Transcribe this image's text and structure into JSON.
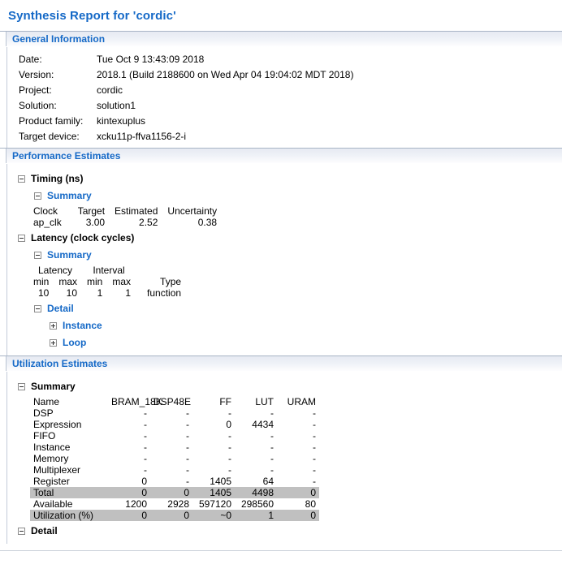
{
  "page": {
    "title": "Synthesis Report for 'cordic'"
  },
  "general_information": {
    "heading": "General Information",
    "rows": [
      {
        "label": "Date:",
        "value": "Tue Oct 9 13:43:09 2018"
      },
      {
        "label": "Version:",
        "value": "2018.1 (Build 2188600 on Wed Apr 04 19:04:02 MDT 2018)"
      },
      {
        "label": "Project:",
        "value": "cordic"
      },
      {
        "label": "Solution:",
        "value": "solution1"
      },
      {
        "label": "Product family:",
        "value": "kintexuplus"
      },
      {
        "label": "Target device:",
        "value": "xcku11p-ffva1156-2-i"
      }
    ]
  },
  "performance_estimates": {
    "heading": "Performance Estimates",
    "timing": {
      "node_label": "Timing (ns)",
      "summary_label": "Summary",
      "headers": [
        "Clock",
        "Target",
        "Estimated",
        "Uncertainty"
      ],
      "rows": [
        {
          "clock": "ap_clk",
          "target": "3.00",
          "estimated": "2.52",
          "uncertainty": "0.38"
        }
      ]
    },
    "latency": {
      "node_label": "Latency (clock cycles)",
      "summary_label": "Summary",
      "group_headers": [
        "Latency",
        "Interval"
      ],
      "headers": [
        "min",
        "max",
        "min",
        "max",
        "Type"
      ],
      "rows": [
        {
          "lat_min": "10",
          "lat_max": "10",
          "int_min": "1",
          "int_max": "1",
          "type": "function"
        }
      ],
      "detail_label": "Detail",
      "detail_items": [
        {
          "label": "Instance",
          "expanded": false
        },
        {
          "label": "Loop",
          "expanded": false
        }
      ]
    }
  },
  "utilization_estimates": {
    "heading": "Utilization Estimates",
    "summary_label": "Summary",
    "headers": [
      "Name",
      "BRAM_18K",
      "DSP48E",
      "FF",
      "LUT",
      "URAM"
    ],
    "rows": [
      {
        "name": "DSP",
        "bram": "-",
        "dsp": "-",
        "ff": "-",
        "lut": "-",
        "uram": "-",
        "highlight": false
      },
      {
        "name": "Expression",
        "bram": "-",
        "dsp": "-",
        "ff": "0",
        "lut": "4434",
        "uram": "-",
        "highlight": false
      },
      {
        "name": "FIFO",
        "bram": "-",
        "dsp": "-",
        "ff": "-",
        "lut": "-",
        "uram": "-",
        "highlight": false
      },
      {
        "name": "Instance",
        "bram": "-",
        "dsp": "-",
        "ff": "-",
        "lut": "-",
        "uram": "-",
        "highlight": false
      },
      {
        "name": "Memory",
        "bram": "-",
        "dsp": "-",
        "ff": "-",
        "lut": "-",
        "uram": "-",
        "highlight": false
      },
      {
        "name": "Multiplexer",
        "bram": "-",
        "dsp": "-",
        "ff": "-",
        "lut": "-",
        "uram": "-",
        "highlight": false
      },
      {
        "name": "Register",
        "bram": "0",
        "dsp": "-",
        "ff": "1405",
        "lut": "64",
        "uram": "-",
        "highlight": false
      },
      {
        "name": "Total",
        "bram": "0",
        "dsp": "0",
        "ff": "1405",
        "lut": "4498",
        "uram": "0",
        "highlight": true
      },
      {
        "name": "Available",
        "bram": "1200",
        "dsp": "2928",
        "ff": "597120",
        "lut": "298560",
        "uram": "80",
        "highlight": false
      },
      {
        "name": "Utilization (%)",
        "bram": "0",
        "dsp": "0",
        "ff": "~0",
        "lut": "1",
        "uram": "0",
        "highlight": true
      }
    ],
    "detail_label": "Detail"
  }
}
